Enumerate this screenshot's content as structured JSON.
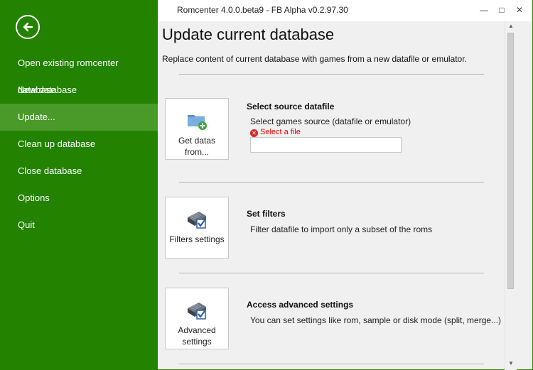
{
  "window": {
    "title": "Romcenter 4.0.0.beta9 - FB Alpha v0.2.97.30",
    "minimize_glyph": "—",
    "maximize_glyph": "□",
    "close_glyph": "✕"
  },
  "sidebar": {
    "back_icon": "back-arrow-icon",
    "items": [
      {
        "label": "Open existing romcenter database"
      },
      {
        "label": "New database"
      },
      {
        "label": "Update..."
      },
      {
        "label": "Clean up database"
      },
      {
        "label": "Close database"
      },
      {
        "label": "Options"
      },
      {
        "label": "Quit"
      }
    ],
    "active_index": 2
  },
  "main": {
    "heading": "Update current database",
    "description": "Replace content of current database with games from a new datafile or emulator.",
    "source": {
      "tile_label": "Get datas from...",
      "title": "Select source datafile",
      "description": "Select games source (datafile or emulator)",
      "error": "Select a file",
      "input_value": ""
    },
    "filters": {
      "tile_label": "Filters settings",
      "title": "Set filters",
      "description": "Filter datafile to import only a subset of the roms"
    },
    "advanced": {
      "tile_label": "Advanced settings",
      "title": "Access advanced settings",
      "description": "You can set settings like rom, sample or disk mode (split, merge...)"
    }
  },
  "colors": {
    "sidebar_bg": "#238200",
    "sidebar_active": "#4a9a2a",
    "error": "#d9272c"
  }
}
